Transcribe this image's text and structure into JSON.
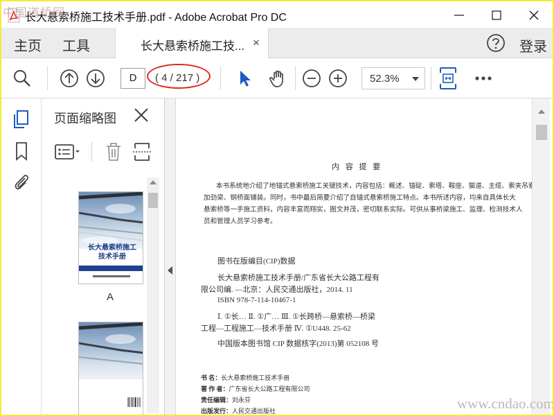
{
  "window": {
    "title": "长大悬索桥施工技术手册.pdf - Adobe Acrobat Pro DC",
    "brand_color": "#e0261c",
    "accent_color": "#1e5bbf"
  },
  "menu": {
    "home": "主页",
    "tools": "工具",
    "doc_tab": "长大悬索桥施工技...",
    "doc_tab_close": "×",
    "login": "登录"
  },
  "toolbar": {
    "page_input": "D",
    "page_count": "( 4 / 217 )",
    "zoom": "52.3%",
    "icons": [
      "search-icon",
      "page-up-icon",
      "page-down-icon",
      "select-arrow-icon",
      "hand-icon",
      "zoom-out-icon",
      "zoom-in-icon",
      "fit-page-icon",
      "more-icon"
    ]
  },
  "sidebar": {
    "rail_icons": [
      "page-thumbnails-icon",
      "bookmark-icon",
      "attachment-icon"
    ],
    "panel_title": "页面缩略图",
    "thumbnails": [
      {
        "label": "A",
        "cover_title_line1": "长大悬索桥施工",
        "cover_title_line2": "技术手册"
      },
      {
        "label": ""
      }
    ]
  },
  "document": {
    "abstract_heading": "内  容  提  要",
    "abstract_lines": [
      "本书系统地介绍了地锚式悬索桥施工关键技术，内容包括：概述、锚碇、索塔、鞍座、猫道、主缆、索夹吊索、",
      "加劲梁、钢桥面铺装。同时，书中最后简要介绍了自锚式悬索桥施工特点。本书所述内容，均来自具体长大",
      "悬索桥等一手施工资料，内容丰富而翔实，图文并茂，密切联系实际。可供从事桥梁施工、监理、检测技术人",
      "员和管理人员学习参考。"
    ],
    "cip_heading": "图书在版编目(CIP)数据",
    "cip_lines": [
      "长大悬索桥施工技术手册/广东省长大公路工程有",
      "限公司编. —北京：人民交通出版社，2014. 11",
      "ISBN  978-7-114-10467-1",
      "Ⅰ. ①长…  Ⅱ. ①广…  Ⅲ. ①长跨桥—悬索桥—桥梁",
      "工程—工程施工—技术手册  Ⅳ. ①U448. 25-62",
      "中国版本图书馆 CIP 数据核字(2013)第 052108 号"
    ],
    "colophon": [
      {
        "k": "书        名：",
        "v": "长大悬索桥施工技术手册"
      },
      {
        "k": "著  作  者：",
        "v": "广东省长大公路工程有限公司"
      },
      {
        "k": "责任编辑：",
        "v": "刘永芬"
      },
      {
        "k": "出版发行：",
        "v": "人民交通出版社"
      }
    ]
  },
  "watermarks": {
    "top_left": "中国道桥网",
    "bottom_right": "www.cndao.com"
  }
}
